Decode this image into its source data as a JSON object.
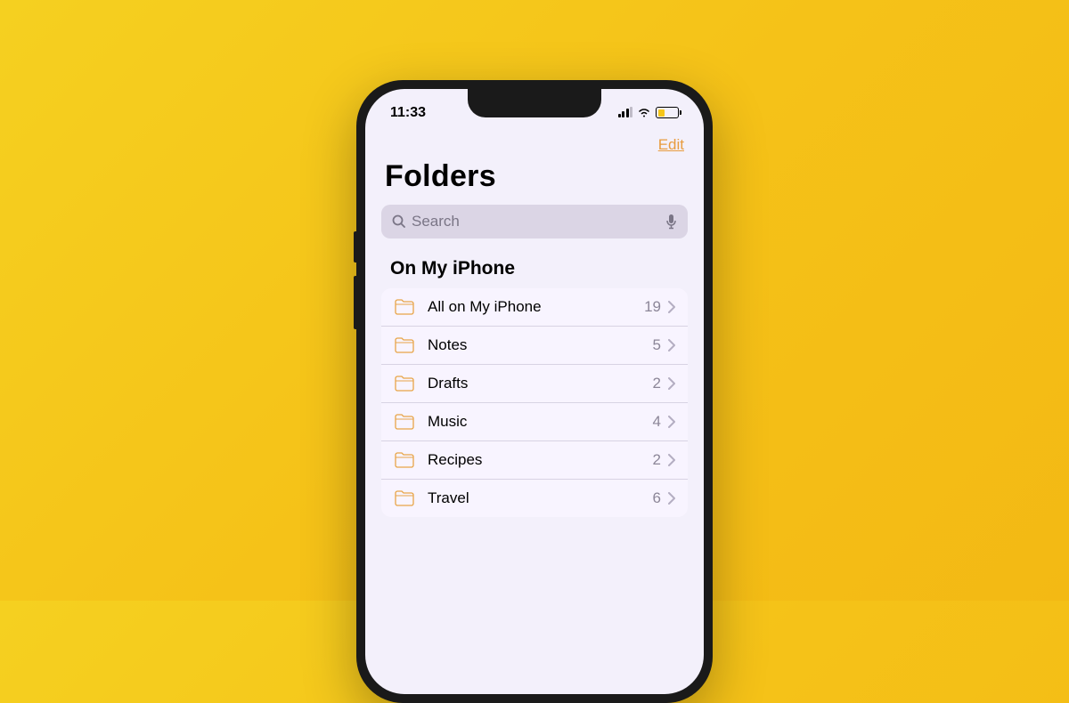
{
  "status": {
    "time": "11:33"
  },
  "nav": {
    "edit_label": "Edit"
  },
  "header": {
    "title": "Folders"
  },
  "search": {
    "placeholder": "Search"
  },
  "section": {
    "title": "On My iPhone"
  },
  "folders": [
    {
      "label": "All on My iPhone",
      "count": "19"
    },
    {
      "label": "Notes",
      "count": "5"
    },
    {
      "label": "Drafts",
      "count": "2"
    },
    {
      "label": "Music",
      "count": "4"
    },
    {
      "label": "Recipes",
      "count": "2"
    },
    {
      "label": "Travel",
      "count": "6"
    }
  ]
}
